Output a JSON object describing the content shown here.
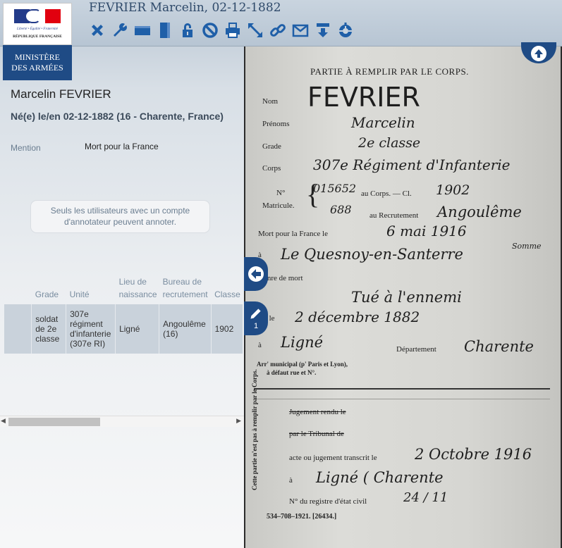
{
  "header": {
    "title": "FEVRIER Marcelin, 02-12-1882",
    "logo_devise": "Liberté • Égalité • Fraternité",
    "logo_republique": "RÉPUBLIQUE FRANÇAISE",
    "logo_ministere_line1": "MINISTÈRE",
    "logo_ministere_line2": "DES ARMÉES"
  },
  "toolbar": {
    "icons": [
      "close-icon",
      "wrench-icon",
      "horizontal-fit-icon",
      "vertical-fit-icon",
      "lock-icon",
      "forbidden-icon",
      "print-icon",
      "fullscreen-icon",
      "link-icon",
      "mail-icon",
      "download-icon",
      "lifebuoy-icon"
    ],
    "color": "#1f5fa8"
  },
  "record": {
    "name": "Marcelin FEVRIER",
    "birth": "Né(e) le/en 02-12-1882 (16 - Charente, France)",
    "mention_label": "Mention",
    "mention_value": "Mort pour la France"
  },
  "annotation_notice": "Seuls les utilisateurs avec un compte d'annotateur peuvent annoter.",
  "table": {
    "headers": [
      "",
      "Grade",
      "Unité",
      "Lieu de naissance",
      "Bureau de recrutement",
      "Classe"
    ],
    "row": [
      "",
      "soldat de 2e classe",
      "307e régiment d'infanterie (307e RI)",
      "Ligné",
      "Angoulême (16)",
      "1902"
    ]
  },
  "document": {
    "printed": {
      "header": "PARTIE À REMPLIR PAR LE CORPS.",
      "nom": "Nom",
      "prenoms": "Prénoms",
      "grade": "Grade",
      "corps": "Corps",
      "no": "N°",
      "matricule": "Matricule.",
      "au_corps": "au Corps. — Cl.",
      "au_recrutement": "au Recrutement",
      "mort_pour": "Mort pour la France le",
      "a": "à",
      "genre": "Genre de mort",
      "ne_le": "Né le",
      "departement": "Département",
      "arr": "Arr' municipal (p' Paris et Lyon),",
      "arr2": "à défaut rue et N°.",
      "jugement": "Jugement rendu le",
      "tribunal": "par le Tribunal de",
      "acte": "acte ou jugement transcrit le",
      "registre": "N° du registre d'état civil",
      "footer": "534–708–1921. [26434.]",
      "vertical": "Cette partie n'est pas à remplir par le Corps."
    },
    "handwritten": {
      "nom": "FEVRIER",
      "prenom": "Marcelin",
      "grade": "2e classe",
      "corps": "307e Régiment d'Infanterie",
      "no": "015652",
      "classe": "1902",
      "matricule": "688",
      "recrutement": "Angoulême",
      "date_mort": "6 mai 1916",
      "lieu_mort": "Le Quesnoy-en-Santerre",
      "lieu_mort_sup": "Somme",
      "genre": "Tué à l'ennemi",
      "date_naissance": "2 décembre 1882",
      "lieu_naissance": "Ligné",
      "departement": "Charente",
      "transcrit": "2 Octobre 1916",
      "lieu_transcrit": "Ligné ( Charente",
      "registre": "24 / 11"
    }
  },
  "viewer": {
    "note_count": "1",
    "nav_icons": [
      "arrow-up-icon",
      "arrow-left-icon",
      "pencil-icon"
    ]
  }
}
